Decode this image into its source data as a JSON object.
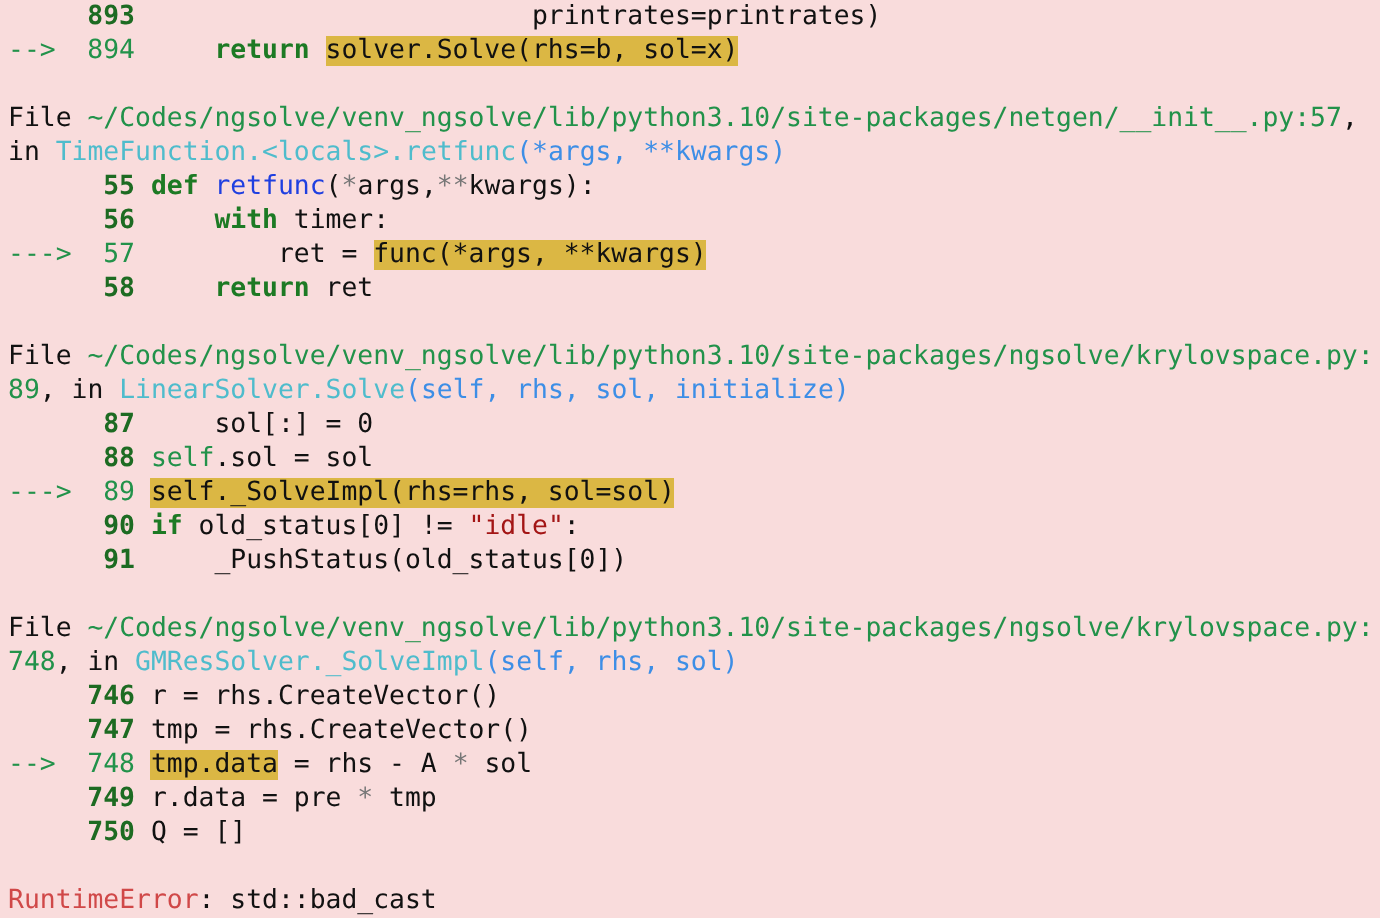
{
  "traceback": [
    {
      "lines": [
        {
          "number": "893",
          "segments": [
            {
              "text": "                        printrates=printrates)",
              "kind": "plain"
            }
          ]
        },
        {
          "marker": "-->",
          "number": "894",
          "segments": [
            {
              "text": "    return ",
              "kind": "keyword"
            },
            {
              "text": "solver.Solve(rhs=b, sol=x)",
              "kind": "highlight"
            }
          ]
        }
      ]
    },
    {
      "header": [
        {
          "text": "File ",
          "kind": "label"
        },
        {
          "text": "~/Codes/ngsolve/venv_ngsolve/lib/python3.10/site-packages/netgen/__init__.py:57",
          "kind": "path"
        },
        {
          "text": ", in ",
          "kind": "label"
        },
        {
          "text": "TimeFunction.<locals>.retfunc",
          "kind": "function"
        },
        {
          "text": "(*args, **kwargs)",
          "kind": "arguments"
        }
      ],
      "lines": [
        {
          "number": "55",
          "segments": [
            {
              "text": "def ",
              "kind": "keyword"
            },
            {
              "text": "retfunc",
              "kind": "name"
            },
            {
              "text": "(",
              "kind": "plain"
            },
            {
              "text": "*",
              "kind": "op"
            },
            {
              "text": "args,",
              "kind": "plain"
            },
            {
              "text": "**",
              "kind": "op"
            },
            {
              "text": "kwargs):",
              "kind": "plain"
            }
          ]
        },
        {
          "number": "56",
          "segments": [
            {
              "text": "    with",
              "kind": "keyword"
            },
            {
              "text": " timer:",
              "kind": "plain"
            }
          ]
        },
        {
          "marker": "--->",
          "number": "57",
          "segments": [
            {
              "text": "        ret = ",
              "kind": "plain"
            },
            {
              "text": "func(*args, **kwargs)",
              "kind": "highlight"
            }
          ]
        },
        {
          "number": "58",
          "segments": [
            {
              "text": "    return",
              "kind": "keyword"
            },
            {
              "text": " ret",
              "kind": "plain"
            }
          ]
        }
      ]
    },
    {
      "header": [
        {
          "text": "File ",
          "kind": "label"
        },
        {
          "text": "~/Codes/ngsolve/venv_ngsolve/lib/python3.10/site-packages/ngsolve/krylovspace.py:89",
          "kind": "path"
        },
        {
          "text": ", in ",
          "kind": "label"
        },
        {
          "text": "LinearSolver.Solve",
          "kind": "function"
        },
        {
          "text": "(self, rhs, sol, initialize)",
          "kind": "arguments"
        }
      ],
      "lines": [
        {
          "number": "87",
          "segments": [
            {
              "text": "    sol[:] = 0",
              "kind": "plain"
            }
          ]
        },
        {
          "number": "88",
          "segments": [
            {
              "text": "self",
              "kind": "keyword-light"
            },
            {
              "text": ".sol = sol",
              "kind": "plain"
            }
          ]
        },
        {
          "marker": "--->",
          "number": "89",
          "segments": [
            {
              "text": "self._SolveImpl(rhs=rhs, sol=sol)",
              "kind": "highlight"
            }
          ]
        },
        {
          "number": "90",
          "segments": [
            {
              "text": "if",
              "kind": "keyword"
            },
            {
              "text": " old_status[0] != ",
              "kind": "plain"
            },
            {
              "text": "\"idle\"",
              "kind": "string"
            },
            {
              "text": ":",
              "kind": "plain"
            }
          ]
        },
        {
          "number": "91",
          "segments": [
            {
              "text": "    _PushStatus(old_status[0])",
              "kind": "plain"
            }
          ]
        }
      ]
    },
    {
      "header": [
        {
          "text": "File ",
          "kind": "label"
        },
        {
          "text": "~/Codes/ngsolve/venv_ngsolve/lib/python3.10/site-packages/ngsolve/krylovspace.py:748",
          "kind": "path"
        },
        {
          "text": ", in ",
          "kind": "label"
        },
        {
          "text": "GMResSolver._SolveImpl",
          "kind": "function"
        },
        {
          "text": "(self, rhs, sol)",
          "kind": "arguments"
        }
      ],
      "lines": [
        {
          "number": "746",
          "segments": [
            {
              "text": "r = rhs.CreateVector()",
              "kind": "plain"
            }
          ]
        },
        {
          "number": "747",
          "segments": [
            {
              "text": "tmp = rhs.CreateVector()",
              "kind": "plain"
            }
          ]
        },
        {
          "marker": "-->",
          "number": "748",
          "segments": [
            {
              "text": "tmp.data",
              "kind": "highlight"
            },
            {
              "text": " = rhs - A ",
              "kind": "plain"
            },
            {
              "text": "*",
              "kind": "op"
            },
            {
              "text": " sol",
              "kind": "plain"
            }
          ]
        },
        {
          "number": "749",
          "segments": [
            {
              "text": "r.data = pre ",
              "kind": "plain"
            },
            {
              "text": "*",
              "kind": "op"
            },
            {
              "text": " tmp",
              "kind": "plain"
            }
          ]
        },
        {
          "number": "750",
          "segments": [
            {
              "text": "Q = []",
              "kind": "plain"
            }
          ]
        }
      ]
    }
  ],
  "error": {
    "type": "RuntimeError",
    "message": ": std::bad_cast"
  }
}
